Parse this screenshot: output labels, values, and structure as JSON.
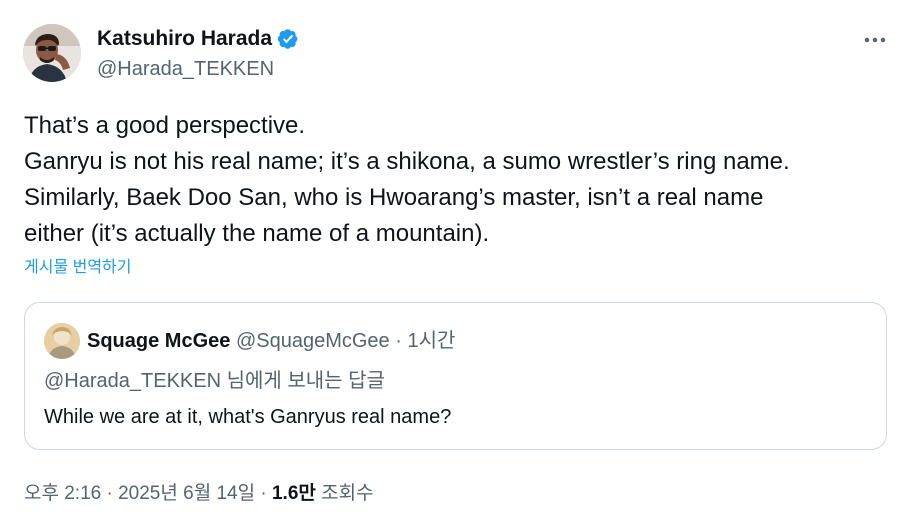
{
  "author": {
    "name": "Katsuhiro Harada",
    "handle": "@Harada_TEKKEN"
  },
  "tweet": {
    "lines": [
      "That’s a good perspective.",
      "Ganryu is not his real name; it’s a shikona, a sumo wrestler’s ring name.",
      "Similarly, Baek Doo San, who is Hwoarang’s master, isn’t a real name",
      "either (it’s actually the name of a mountain)."
    ],
    "translate_label": "게시물 번역하기"
  },
  "quoted": {
    "name": "Squage McGee",
    "handle": "@SquageMcGee",
    "separator": "·",
    "time": "1시간",
    "reply_to": "@Harada_TEKKEN 님에게 보내는 답글",
    "text": "While we are at it, what's Ganryus real name?"
  },
  "meta": {
    "time": "오후 2:16",
    "separator1": "·",
    "date": "2025년 6월 14일",
    "separator2": "·",
    "views_count": "1.6만",
    "views_label": "조회수"
  },
  "colors": {
    "accent": "#1d9bf0",
    "secondary_text": "#536471",
    "border": "#cfd9de"
  },
  "icons": {
    "verified": "verified-badge-icon",
    "more": "more-options-icon"
  }
}
